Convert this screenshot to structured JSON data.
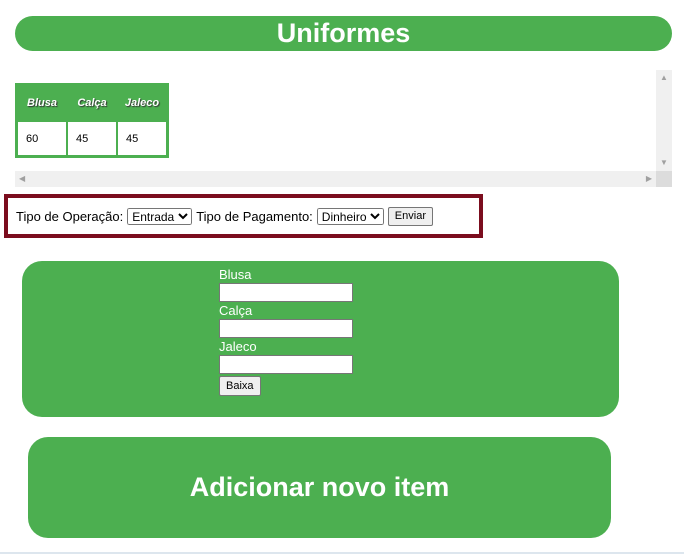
{
  "header": {
    "title": "Uniformes"
  },
  "stock_table": {
    "columns": [
      "Blusa",
      "Calça",
      "Jaleco"
    ],
    "values": [
      "60",
      "45",
      "45"
    ]
  },
  "operation": {
    "type_label": "Tipo de Operação:",
    "type_selected": "Entrada",
    "payment_label": "Tipo de Pagamento:",
    "payment_selected": "Dinheiro",
    "submit_label": "Enviar"
  },
  "form": {
    "blusa_label": "Blusa",
    "calca_label": "Calça",
    "jaleco_label": "Jaleco",
    "submit_label": "Baixa"
  },
  "add_item": {
    "label": "Adicionar novo item"
  },
  "colors": {
    "accent_green": "#4caf50",
    "border_maroon": "#7b0d1e"
  }
}
